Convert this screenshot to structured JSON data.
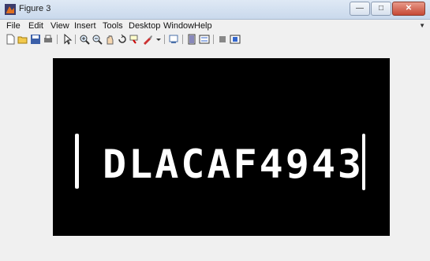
{
  "window": {
    "title": "Figure 3"
  },
  "menu": [
    "File",
    "Edit",
    "View",
    "Insert",
    "Tools",
    "Desktop",
    "Window",
    "Help"
  ],
  "toolbar_icons": [
    "new-figure-icon",
    "open-file-icon",
    "save-icon",
    "print-icon",
    "pointer-icon",
    "zoom-in-icon",
    "zoom-out-icon",
    "pan-icon",
    "rotate-icon",
    "data-cursor-icon",
    "brush-icon",
    "link-icon",
    "colorbar-icon",
    "legend-icon",
    "hide-plot-tools-icon",
    "show-plot-tools-icon"
  ],
  "figure": {
    "plate_text": "DLACAF4943",
    "background": "#000000",
    "foreground": "#ffffff"
  }
}
